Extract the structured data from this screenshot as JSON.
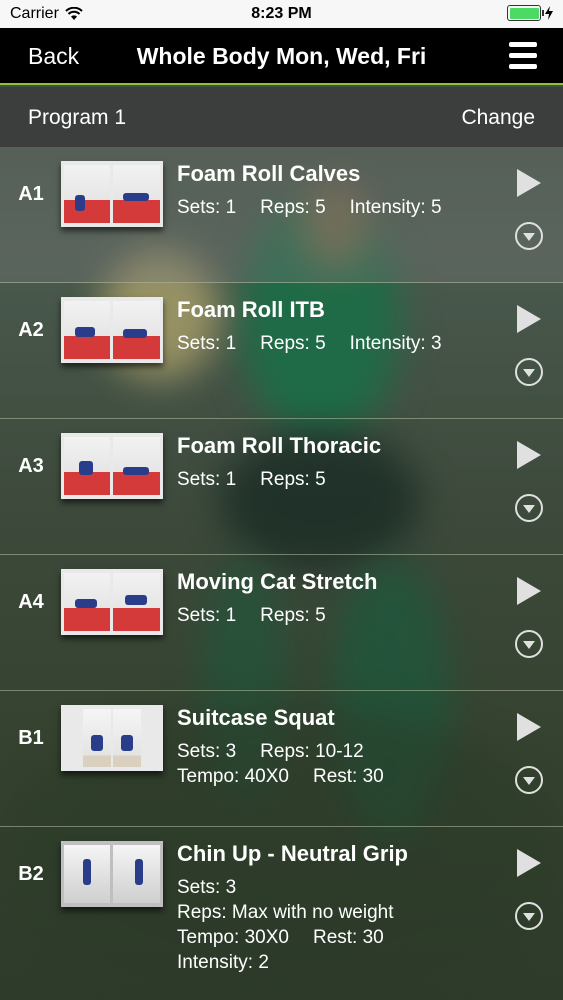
{
  "status_bar": {
    "carrier": "Carrier",
    "time": "8:23 PM"
  },
  "nav": {
    "back": "Back",
    "title": "Whole Body Mon, Wed, Fri",
    "menu_icon": "hamburger-menu-icon"
  },
  "program": {
    "label": "Program 1",
    "change": "Change"
  },
  "exercises": [
    {
      "code": "A1",
      "name": "Foam Roll Calves",
      "sets": "Sets: 1",
      "reps": "Reps: 5",
      "intensity": "Intensity: 5"
    },
    {
      "code": "A2",
      "name": "Foam Roll ITB",
      "sets": "Sets: 1",
      "reps": "Reps: 5",
      "intensity": "Intensity: 3"
    },
    {
      "code": "A3",
      "name": "Foam Roll Thoracic",
      "sets": "Sets: 1",
      "reps": "Reps: 5"
    },
    {
      "code": "A4",
      "name": "Moving Cat Stretch",
      "sets": "Sets: 1",
      "reps": "Reps: 5"
    },
    {
      "code": "B1",
      "name": "Suitcase Squat",
      "sets": "Sets: 3",
      "reps": "Reps: 10-12",
      "tempo": "Tempo: 40X0",
      "rest": "Rest: 30"
    },
    {
      "code": "B2",
      "name": "Chin Up - Neutral Grip",
      "sets": "Sets: 3",
      "reps": "Reps: Max with no weight",
      "tempo": "Tempo: 30X0",
      "rest": "Rest: 30",
      "intensity": "Intensity: 2"
    }
  ],
  "colors": {
    "accent": "#8fc43a",
    "nav_bg": "#000000",
    "battery": "#4cd964"
  }
}
